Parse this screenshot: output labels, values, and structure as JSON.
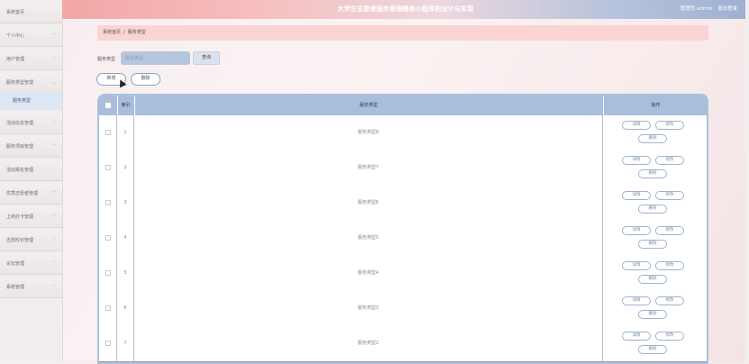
{
  "header": {
    "title": "大学生志愿者服务管理微信小程序的设计与实现",
    "user_role": "管理员 admin",
    "logout": "退出登录"
  },
  "sidebar": {
    "items": [
      {
        "label": "系统首页"
      },
      {
        "label": "个人中心"
      },
      {
        "label": "用户管理"
      },
      {
        "label": "服务类型管理"
      },
      {
        "label": "活动信息管理"
      },
      {
        "label": "服务项目管理"
      },
      {
        "label": "活动报名管理"
      },
      {
        "label": "优秀志愿者管理"
      },
      {
        "label": "上岗打卡管理"
      },
      {
        "label": "志愿时长管理"
      },
      {
        "label": "论坛管理"
      },
      {
        "label": "系统管理"
      }
    ],
    "active_sub": "服务类型"
  },
  "breadcrumb": {
    "home": "系统首页",
    "separator": "/",
    "current": "服务类型"
  },
  "search": {
    "label": "服务类型",
    "placeholder": "服务类型",
    "button": "查询"
  },
  "toolbar": {
    "add": "新增",
    "delete": "删除"
  },
  "table": {
    "headers": {
      "index": "索引",
      "type": "服务类型",
      "actions": "操作"
    },
    "action_labels": {
      "detail": "详情",
      "edit": "修改",
      "delete": "删除"
    },
    "rows": [
      {
        "index": "1",
        "type": "服务类型8"
      },
      {
        "index": "2",
        "type": "服务类型7"
      },
      {
        "index": "3",
        "type": "服务类型6"
      },
      {
        "index": "4",
        "type": "服务类型5"
      },
      {
        "index": "5",
        "type": "服务类型4"
      },
      {
        "index": "6",
        "type": "服务类型3"
      },
      {
        "index": "7",
        "type": "服务类型2"
      }
    ]
  }
}
